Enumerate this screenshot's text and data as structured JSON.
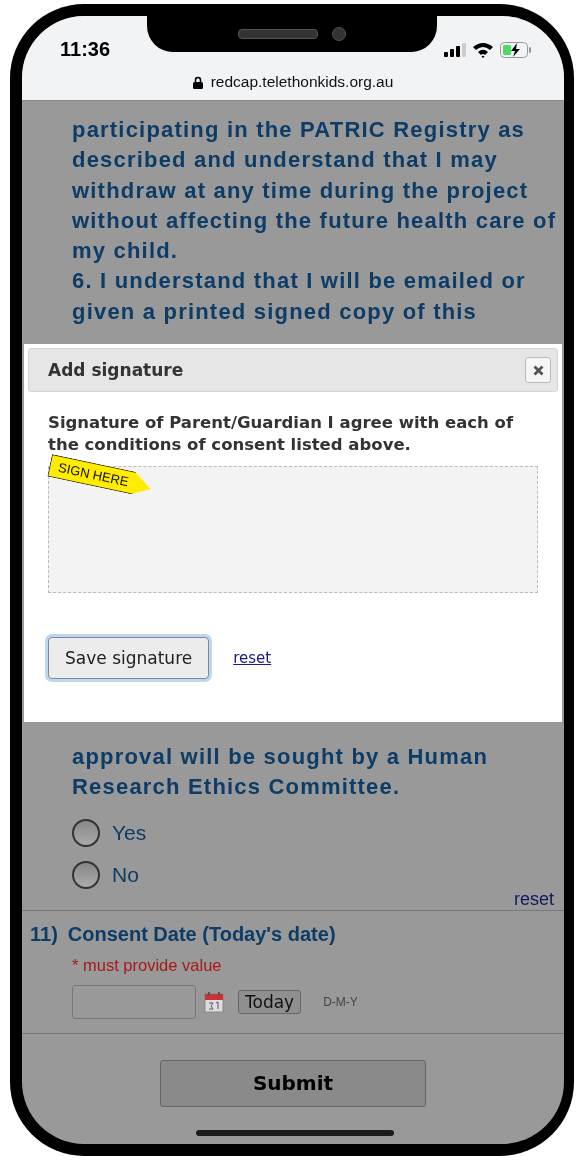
{
  "status_bar": {
    "time": "11:36"
  },
  "address_bar": {
    "url": "redcap.telethonkids.org.au"
  },
  "consent_items": [
    {
      "text": "participating in the PATRIC Registry as described and understand that I may withdraw at any time during the project without affecting the future health care of my child."
    },
    {
      "text": "6. I understand that I will be emailed or given a printed signed copy of this"
    },
    {
      "text": "approval will be sought by a Human Research Ethics Committee."
    }
  ],
  "question_options": [
    {
      "label": "Yes",
      "selected": false
    },
    {
      "label": "No",
      "selected": false
    }
  ],
  "reset_link": "reset",
  "date_question": {
    "number": "11)",
    "label": "Consent Date (Today's date)",
    "required_note": "* must provide value",
    "today_button": "Today",
    "format": "D-M-Y"
  },
  "submit_button": "Submit",
  "dialog": {
    "title": "Add signature",
    "prompt": "Signature of Parent/Guardian I agree with each of the conditions of consent listed above.",
    "sign_here": "SIGN HERE",
    "save_button": "Save signature",
    "reset_link": "reset"
  }
}
